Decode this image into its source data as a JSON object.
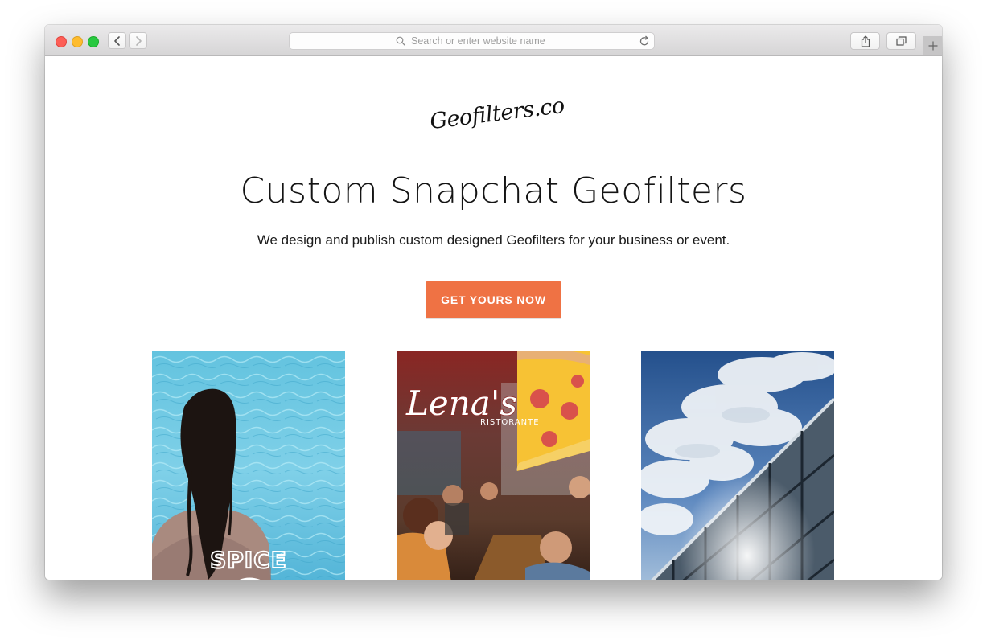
{
  "browser": {
    "address_placeholder": "Search or enter website name",
    "icons": [
      "chevron-left-icon",
      "chevron-right-icon",
      "search-icon",
      "reload-icon",
      "share-icon",
      "tabs-icon",
      "plus-icon"
    ]
  },
  "page": {
    "logo": "Geofilters.co",
    "headline": "Custom Snapchat Geofilters",
    "subheadline": "We design and publish custom designed Geofilters for your business or event.",
    "cta_label": "GET YOURS NOW",
    "accent_color": "#ef7244"
  },
  "gallery": [
    {
      "overlay_text": "SPICE",
      "scene": "swimmer-pool"
    },
    {
      "overlay_title": "Lena's",
      "overlay_sub": "RISTORANTE",
      "scene": "restaurant-pizza"
    },
    {
      "scene": "sky-building"
    }
  ]
}
